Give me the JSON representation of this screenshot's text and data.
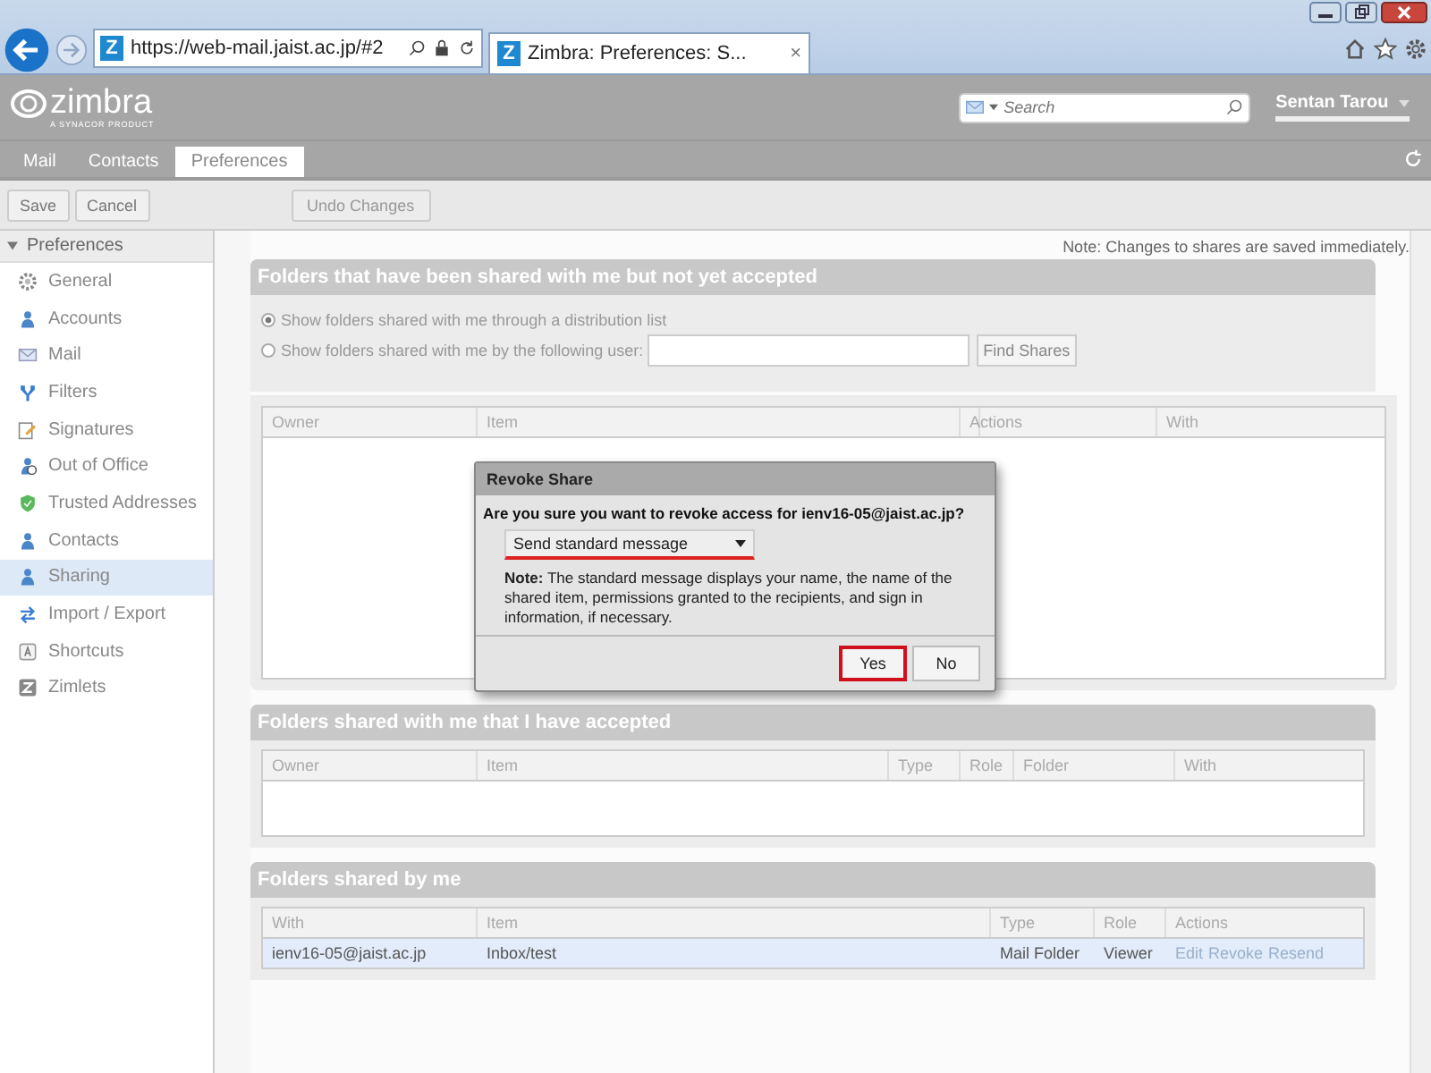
{
  "browser": {
    "url": "https://web-mail.jaist.ac.jp/#2",
    "tab_title": "Zimbra: Preferences: S...",
    "tab_close": "×",
    "favicon": "Z",
    "tab_favicon": "Z"
  },
  "header": {
    "logo": "zimbra",
    "logo_sub": "A SYNACOR PRODUCT",
    "search_placeholder": "Search",
    "user": "Sentan Tarou"
  },
  "tabs": [
    {
      "label": "Mail",
      "selected": false
    },
    {
      "label": "Contacts",
      "selected": false
    },
    {
      "label": "Preferences",
      "selected": true
    }
  ],
  "toolbar": [
    {
      "label": "Save",
      "disabled": false
    },
    {
      "label": "Cancel",
      "disabled": false
    },
    {
      "label": "Undo Changes",
      "disabled": true
    }
  ],
  "sidebar": {
    "title": "Preferences",
    "expanded": true,
    "items": [
      {
        "label": "General",
        "selected": false
      },
      {
        "label": "Accounts",
        "selected": false
      },
      {
        "label": "Mail",
        "selected": false
      },
      {
        "label": "Filters",
        "selected": false
      },
      {
        "label": "Signatures",
        "selected": false
      },
      {
        "label": "Out of Office",
        "selected": false
      },
      {
        "label": "Trusted Addresses",
        "selected": false
      },
      {
        "label": "Contacts",
        "selected": false
      },
      {
        "label": "Sharing",
        "selected": true
      },
      {
        "label": "Import / Export",
        "selected": false
      },
      {
        "label": "Shortcuts",
        "selected": false
      },
      {
        "label": "Zimlets",
        "selected": false
      }
    ]
  },
  "note": "Note: Changes to shares are saved immediately.",
  "pending": {
    "title": "Folders that have been shared with me but not yet accepted",
    "radios": [
      {
        "label": "Show folders shared with me through a distribution list",
        "selected": true
      },
      {
        "label": "Show folders shared with me by the following user:",
        "selected": false
      }
    ],
    "find_button": "Find Shares",
    "columns": [
      "Owner",
      "Item",
      "",
      "",
      "",
      "Actions",
      "With"
    ]
  },
  "accepted": {
    "title": "Folders shared with me that I have accepted",
    "columns": [
      "Owner",
      "Item",
      "Type",
      "Role",
      "Folder",
      "With"
    ]
  },
  "shared_by_me": {
    "title": "Folders shared by me",
    "columns": [
      "With",
      "Item",
      "Type",
      "Role",
      "Actions"
    ],
    "rows": [
      {
        "cells": [
          "ienv16-05@jaist.ac.jp",
          "Inbox/test",
          "Mail Folder",
          "Viewer"
        ],
        "actions": [
          "Edit",
          "Revoke",
          "Resend"
        ],
        "selected": true
      }
    ]
  },
  "dialog": {
    "title": "Revoke Share",
    "question": "Are you sure you want to revoke access for ienv16-05@jaist.ac.jp?",
    "select_value": "Send standard message",
    "note": "**Note:** The standard message displays your name, the name of the shared item, permissions granted to the recipients, and sign in information, if necessary.",
    "buttons": [
      {
        "label": "Yes",
        "focused": true
      },
      {
        "label": "No",
        "focused": false
      }
    ]
  }
}
